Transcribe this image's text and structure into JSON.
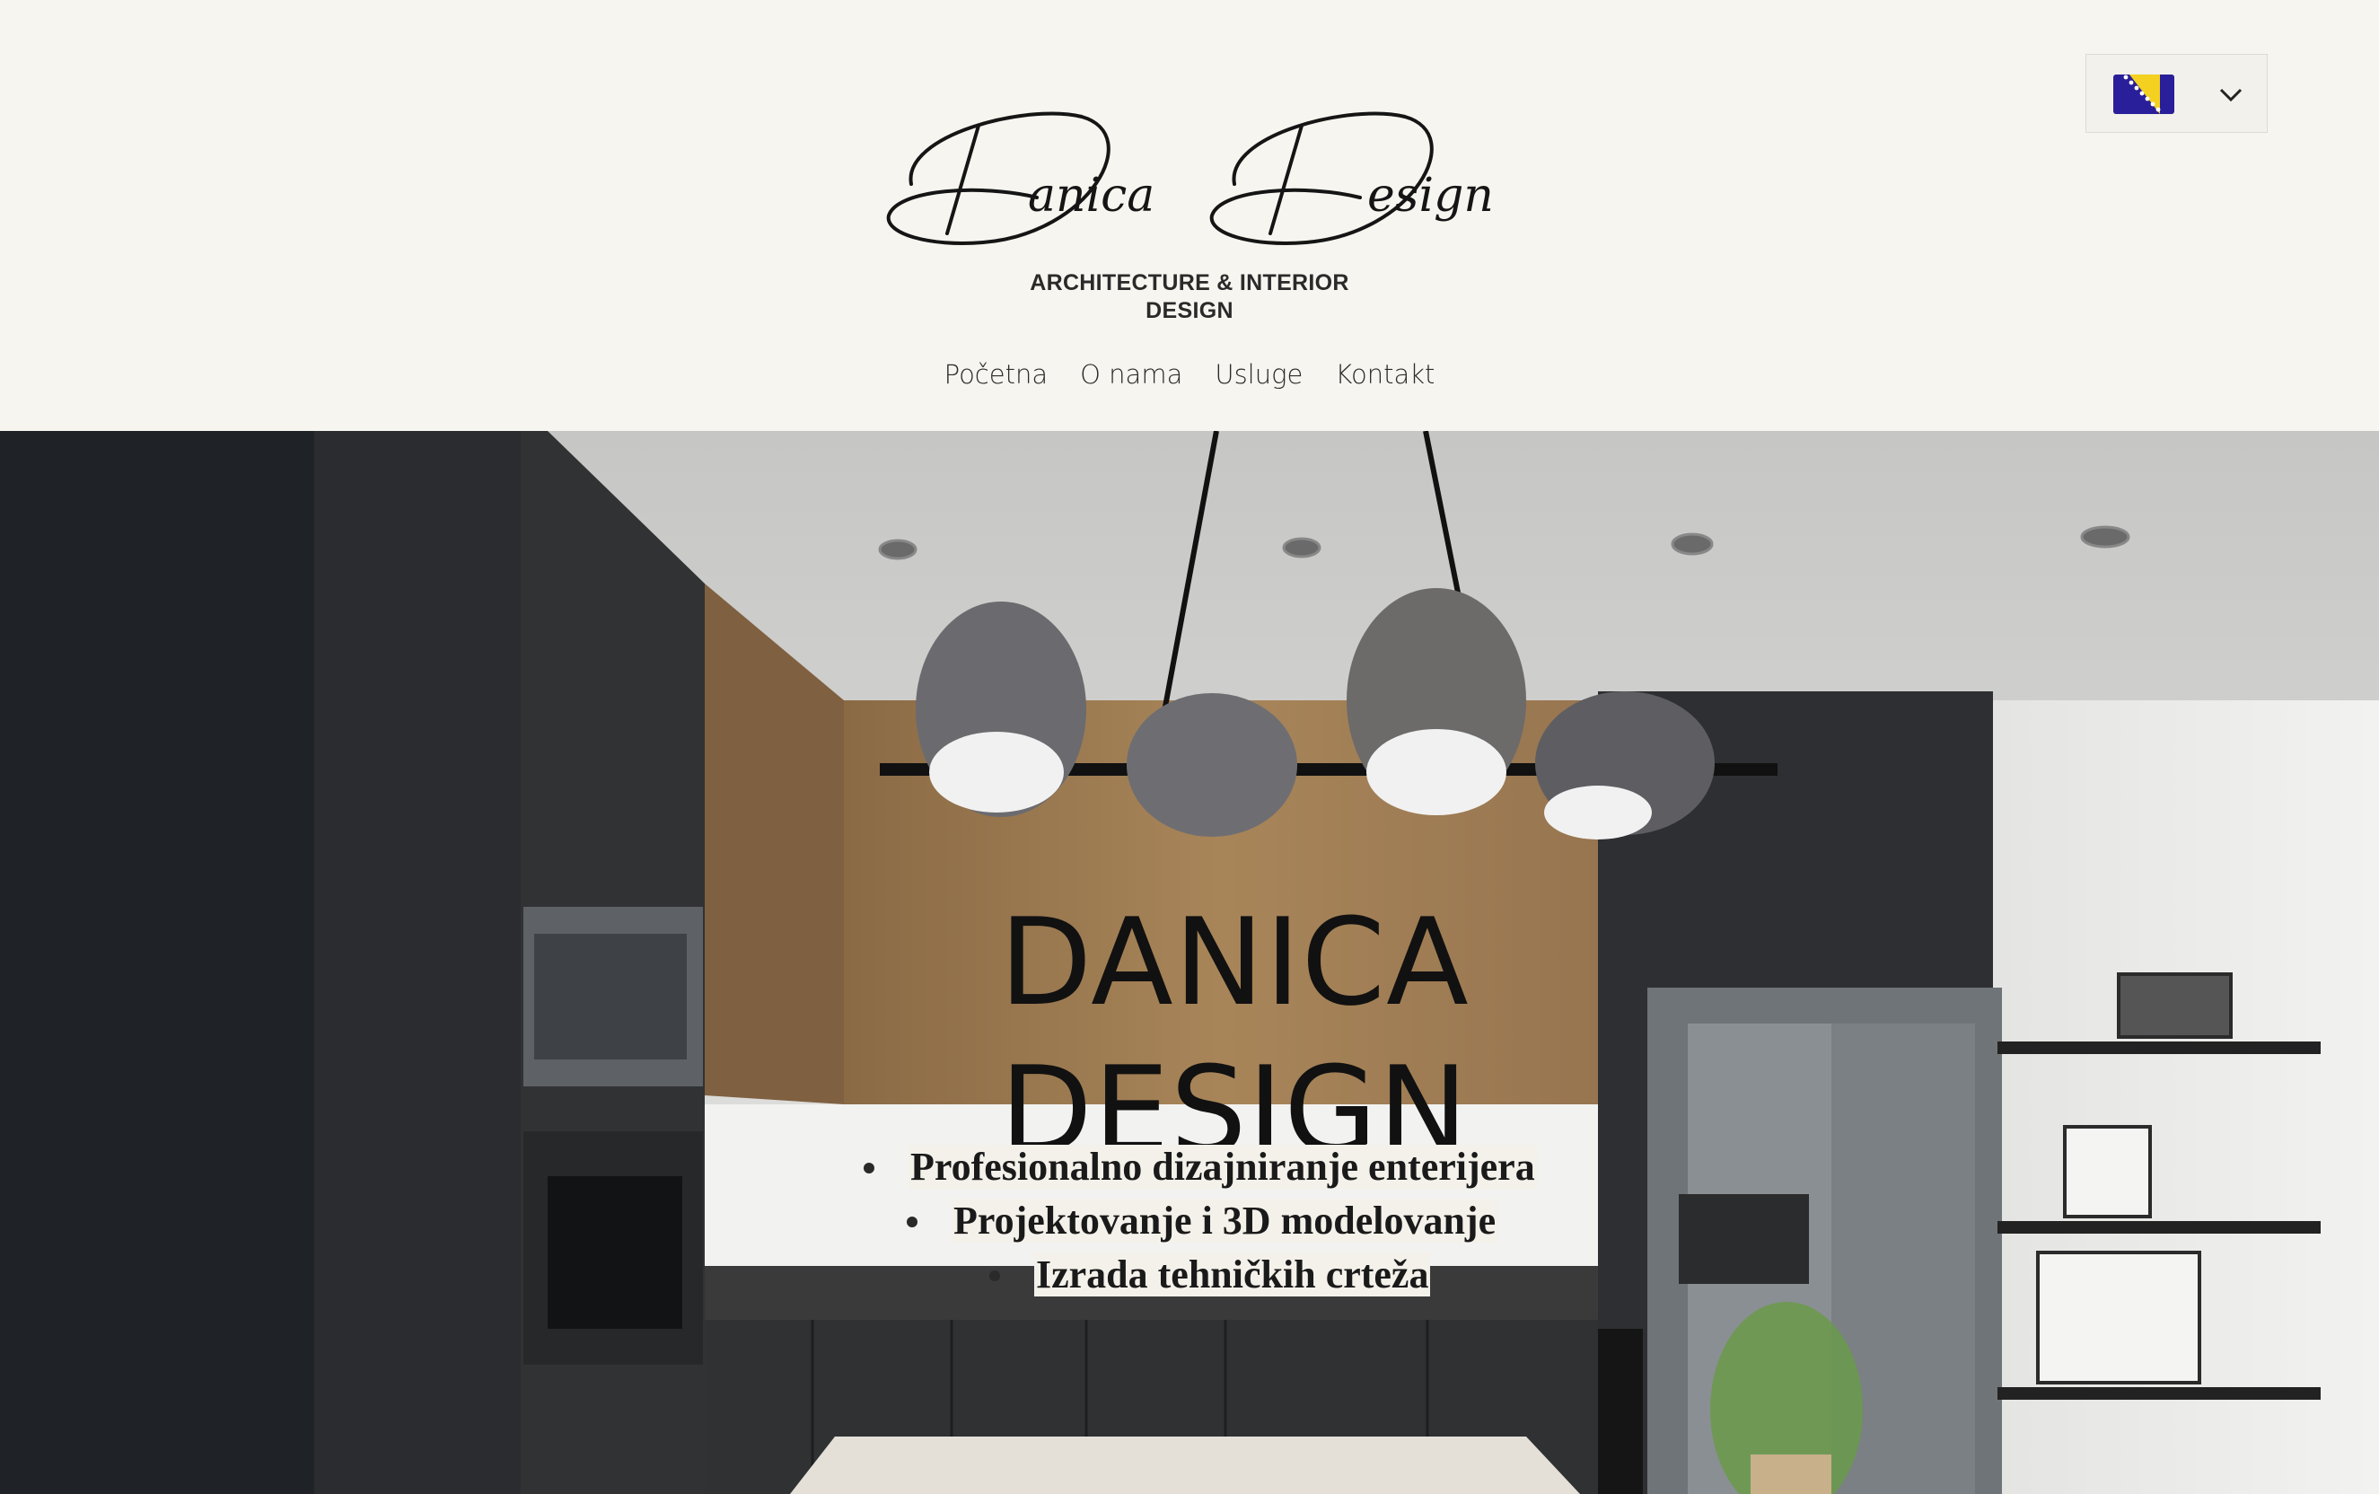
{
  "header": {
    "logo": {
      "script_text": "Danica Design",
      "tagline_line1": "ARCHITECTURE & INTERIOR",
      "tagline_line2": "DESIGN"
    },
    "language": {
      "selected": "Bosnian",
      "flag_icon": "bosnia-flag-icon",
      "dropdown_icon": "chevron-down-icon"
    }
  },
  "nav": {
    "items": [
      {
        "label": "Početna"
      },
      {
        "label": "O nama"
      },
      {
        "label": "Usluge"
      },
      {
        "label": "Kontakt"
      }
    ]
  },
  "hero": {
    "title_line1": "DANICA",
    "title_line2": "DESIGN",
    "bullets": [
      "Profesionalno dizajniranje enterijera",
      "Projektovanje i 3D modelovanje",
      "Izrada tehničkih crteža"
    ],
    "image_description_icon": "kitchen-interior-image"
  },
  "colors": {
    "background": "#f7f5ef",
    "text": "#111111",
    "flag_blue": "#1e1a8a",
    "flag_yellow": "#f4d020"
  }
}
